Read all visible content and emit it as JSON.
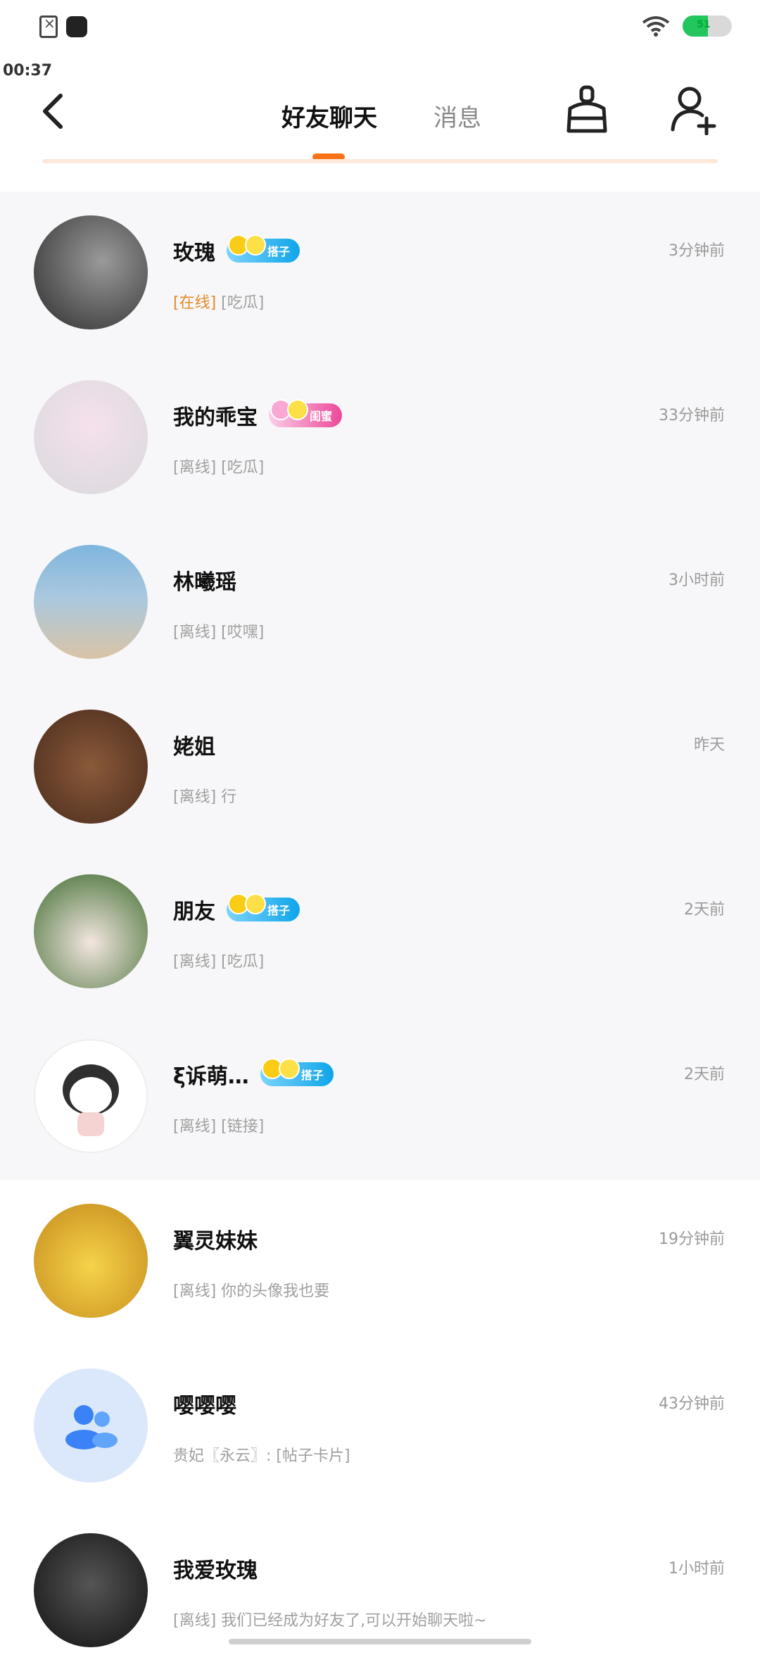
{
  "status_bar": {
    "time": "00:37",
    "battery_label": "51",
    "battery_level": 0.51,
    "icons": [
      "document-error-icon",
      "app-notification-icon",
      "wifi-icon",
      "battery-icon"
    ]
  },
  "header": {
    "tabs": [
      {
        "label": "好友聊天",
        "active": true
      },
      {
        "label": "消息",
        "active": false
      }
    ],
    "icons": [
      "back-arrow-icon",
      "clean-broom-icon",
      "add-friend-icon"
    ],
    "accent_color": "#f97316"
  },
  "chats": [
    {
      "name": "玫瑰",
      "badge": "搭子",
      "badge_style": "blue",
      "time": "3分钟前",
      "status": "[在线]",
      "online": true,
      "message": "[吃瓜]"
    },
    {
      "name": "我的乖宝",
      "badge": "闺蜜",
      "badge_style": "pink",
      "time": "33分钟前",
      "status": "[离线]",
      "online": false,
      "message": "[吃瓜]"
    },
    {
      "name": "林曦瑶",
      "badge": "",
      "time": "3小时前",
      "status": "[离线]",
      "online": false,
      "message": "[哎嘿]"
    },
    {
      "name": "姥姐",
      "badge": "",
      "time": "昨天",
      "status": "[离线]",
      "online": false,
      "message": "行"
    },
    {
      "name": "朋友",
      "badge": "搭子",
      "badge_style": "blue",
      "time": "2天前",
      "status": "[离线]",
      "online": false,
      "message": "[吃瓜]"
    },
    {
      "name": "ξ诉萌…",
      "badge": "搭子",
      "badge_style": "blue",
      "time": "2天前",
      "status": "[离线]",
      "online": false,
      "message": "[链接]"
    },
    {
      "name": "翼灵妹妹",
      "badge": "",
      "time": "19分钟前",
      "status": "[离线]",
      "online": false,
      "message": "你的头像我也要"
    },
    {
      "name": "嘤嘤嘤",
      "badge": "",
      "time": "43分钟前",
      "status": "",
      "online": false,
      "message": "贵妃〖永云〗: [帖子卡片]"
    },
    {
      "name": "我爱玫瑰",
      "badge": "",
      "time": "1小时前",
      "status": "[离线]",
      "online": false,
      "message": "我们已经成为好友了,可以开始聊天啦~"
    }
  ]
}
